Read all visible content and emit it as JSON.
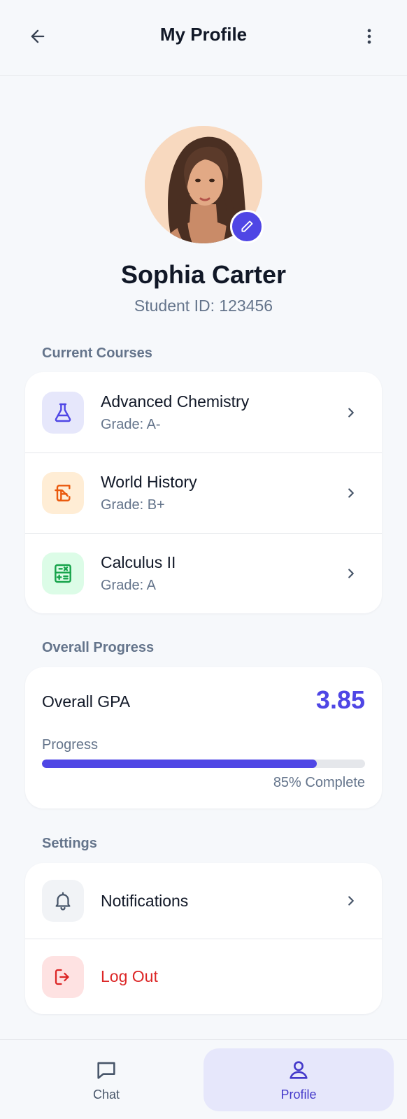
{
  "header": {
    "title": "My Profile",
    "back_icon": "arrow-left-icon",
    "more_icon": "more-vertical-icon"
  },
  "profile": {
    "name": "Sophia Carter",
    "student_id": "Student ID: 123456",
    "edit_icon": "pencil-icon"
  },
  "courses": {
    "section_label": "Current Courses",
    "items": [
      {
        "title": "Advanced Chemistry",
        "grade": "Grade: A-",
        "icon": "flask-icon",
        "icon_color": "#4f46e5",
        "icon_bg": "#e6e7fb"
      },
      {
        "title": "World History",
        "grade": "Grade: B+",
        "icon": "scroll-icon",
        "icon_color": "#ea580c",
        "icon_bg": "#ffedd5"
      },
      {
        "title": "Calculus II",
        "grade": "Grade: A",
        "icon": "calculator-icon",
        "icon_color": "#16a34a",
        "icon_bg": "#dcfce7"
      }
    ]
  },
  "progress": {
    "section_label": "Overall Progress",
    "gpa_label": "Overall GPA",
    "gpa_value": "3.85",
    "progress_label": "Progress",
    "percent": 85,
    "progress_text": "85% Complete"
  },
  "settings": {
    "section_label": "Settings",
    "notifications_label": "Notifications",
    "notifications_icon": "bell-icon",
    "logout_label": "Log Out",
    "logout_icon": "logout-icon",
    "logout_color": "#dc2626"
  },
  "nav": {
    "chat_label": "Chat",
    "profile_label": "Profile",
    "active": "Profile"
  },
  "colors": {
    "accent": "#4f46e5",
    "background": "#f6f8fb"
  }
}
